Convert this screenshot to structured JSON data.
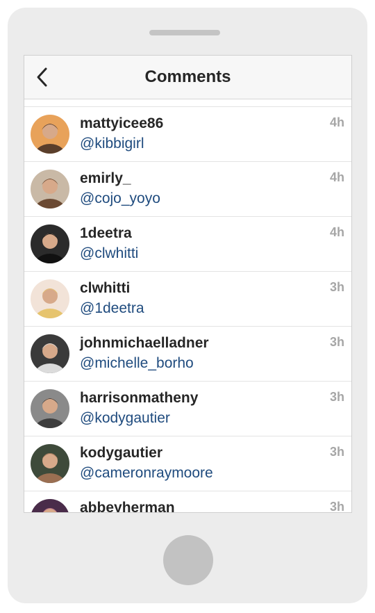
{
  "nav": {
    "title": "Comments"
  },
  "comments": [
    {
      "username": "mattyicee86",
      "mention": "@kibbigirl",
      "time": "4h",
      "avatar_colors": [
        "#e8a25a",
        "#5a3e2b"
      ]
    },
    {
      "username": "emirly_",
      "mention": "@cojo_yoyo",
      "time": "4h",
      "avatar_colors": [
        "#c9b9a6",
        "#6b4a33"
      ]
    },
    {
      "username": "1deetra",
      "mention": "@clwhitti",
      "time": "4h",
      "avatar_colors": [
        "#2b2b2b",
        "#111111"
      ]
    },
    {
      "username": "clwhitti",
      "mention": "@1deetra",
      "time": "3h",
      "avatar_colors": [
        "#f2e3d8",
        "#e6c46e"
      ]
    },
    {
      "username": "johnmichaelladner",
      "mention": "@michelle_borho",
      "time": "3h",
      "avatar_colors": [
        "#3a3a3a",
        "#dcdcdc"
      ]
    },
    {
      "username": "harrisonmatheny",
      "mention": "@kodygautier",
      "time": "3h",
      "avatar_colors": [
        "#8a8a8a",
        "#3d3d3d"
      ]
    },
    {
      "username": "kodygautier",
      "mention": "@cameronraymoore",
      "time": "3h",
      "avatar_colors": [
        "#3e4a3a",
        "#9a6f52"
      ]
    },
    {
      "username": "abbeyherman",
      "mention": "",
      "time": "3h",
      "avatar_colors": [
        "#4a2c4a",
        "#b46a8a"
      ]
    }
  ]
}
